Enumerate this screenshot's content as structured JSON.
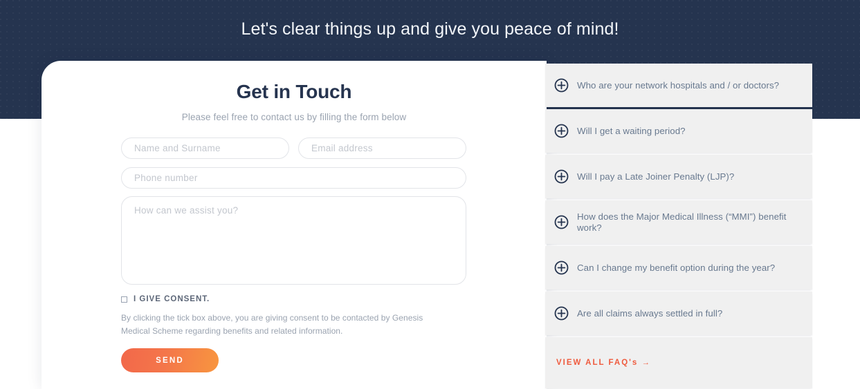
{
  "hero": {
    "title": "Let's clear things up and give you peace of mind!",
    "background_color": "#25344f"
  },
  "form": {
    "title": "Get in Touch",
    "subtitle": "Please feel free to contact us by filling the form below",
    "fields": {
      "name": {
        "placeholder": "Name and Surname",
        "value": ""
      },
      "email": {
        "placeholder": "Email address",
        "value": ""
      },
      "phone": {
        "placeholder": "Phone number",
        "value": ""
      },
      "message": {
        "placeholder": "How can we assist you?",
        "value": ""
      }
    },
    "consent": {
      "label": "I GIVE CONSENT.",
      "checked": false,
      "disclaimer": "By clicking the tick box above, you are giving consent to be contacted by Genesis Medical Scheme regarding benefits and related information."
    },
    "submit_label": "SEND",
    "submit_color": "#f4764a"
  },
  "faq": {
    "items": [
      {
        "icon": "plus-circle-icon",
        "question": "Who are your network hospitals and / or doctors?"
      },
      {
        "icon": "plus-circle-icon",
        "question": "Will I get a waiting period?"
      },
      {
        "icon": "plus-circle-icon",
        "question": "Will I pay a Late Joiner Penalty (LJP)?"
      },
      {
        "icon": "plus-circle-icon",
        "question": "How does the Major Medical Illness (“MMI”) benefit work?"
      },
      {
        "icon": "plus-circle-icon",
        "question": "Can I change my benefit option during the year?"
      },
      {
        "icon": "plus-circle-icon",
        "question": "Are all claims always settled in full?"
      }
    ],
    "view_all_label": "VIEW ALL FAQ's →",
    "view_all_color": "#ef5b3e"
  }
}
